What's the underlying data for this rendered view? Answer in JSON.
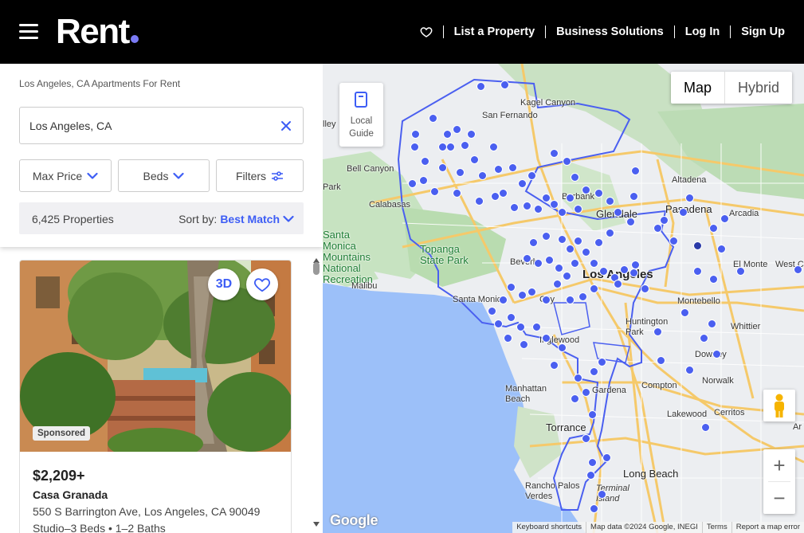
{
  "header": {
    "logo_text": "Rent",
    "nav": {
      "list_property": "List a Property",
      "business": "Business Solutions",
      "login": "Log In",
      "signup": "Sign Up"
    }
  },
  "search": {
    "breadcrumb": "Los Angeles, CA Apartments For Rent",
    "location_value": "Los Angeles, CA",
    "filters": {
      "max_price": "Max Price",
      "beds": "Beds",
      "filters": "Filters"
    },
    "count": "6,425 Properties",
    "sort_label": "Sort by:",
    "sort_value": "Best Match"
  },
  "listing": {
    "badge_3d": "3D",
    "sponsored": "Sponsored",
    "price": "$2,209+",
    "name": "Casa Granada",
    "address": "550 S Barrington Ave, Los Angeles, CA 90049",
    "beds_baths": "Studio–3 Beds • 1–2 Baths"
  },
  "map": {
    "local_guide": "Local Guide",
    "map_type": {
      "map": "Map",
      "hybrid": "Hybrid"
    },
    "google": "Google",
    "attribution": {
      "shortcuts": "Keyboard shortcuts",
      "data": "Map data ©2024 Google, INEGI",
      "terms": "Terms",
      "report": "Report a map error"
    },
    "places": {
      "kagel": "Kagel Canyon",
      "sanfernando": "San Fernando",
      "valley": "lley",
      "bellcanyon": "Bell Canyon",
      "park": "Park",
      "calabasas": "Calabasas",
      "altadena": "Altadena",
      "pasadena": "Pasadena",
      "arcadia": "Arcadia",
      "glendale": "Glendale",
      "burbank": "Burbank",
      "santamonica_mtn": "Santa Monica Mountains National Recreation",
      "topanga": "Topanga State Park",
      "malibu": "Malibu",
      "santamonica": "Santa Monica",
      "beverly": "Beverly",
      "losangeles": "Los Angeles",
      "elmonte": "El Monte",
      "westc": "West C",
      "montebello": "Montebello",
      "huntington": "Huntington Park",
      "whittier": "Whittier",
      "inglewood": "Inglewood",
      "downey": "Downey",
      "manhattan": "Manhattan Beach",
      "gardena": "Gardena",
      "compton": "Compton",
      "norwalk": "Norwalk",
      "lakewood": "Lakewood",
      "cerritos": "Cerritos",
      "torrance": "Torrance",
      "longbeach": "Long Beach",
      "rancho": "Rancho Palos Verdes",
      "terminal": "Terminal Island",
      "ar": "Ar",
      "city": "City"
    }
  },
  "colors": {
    "accent": "#3d5df5",
    "marker": "#4a5ff0",
    "header_bg": "#000000"
  }
}
